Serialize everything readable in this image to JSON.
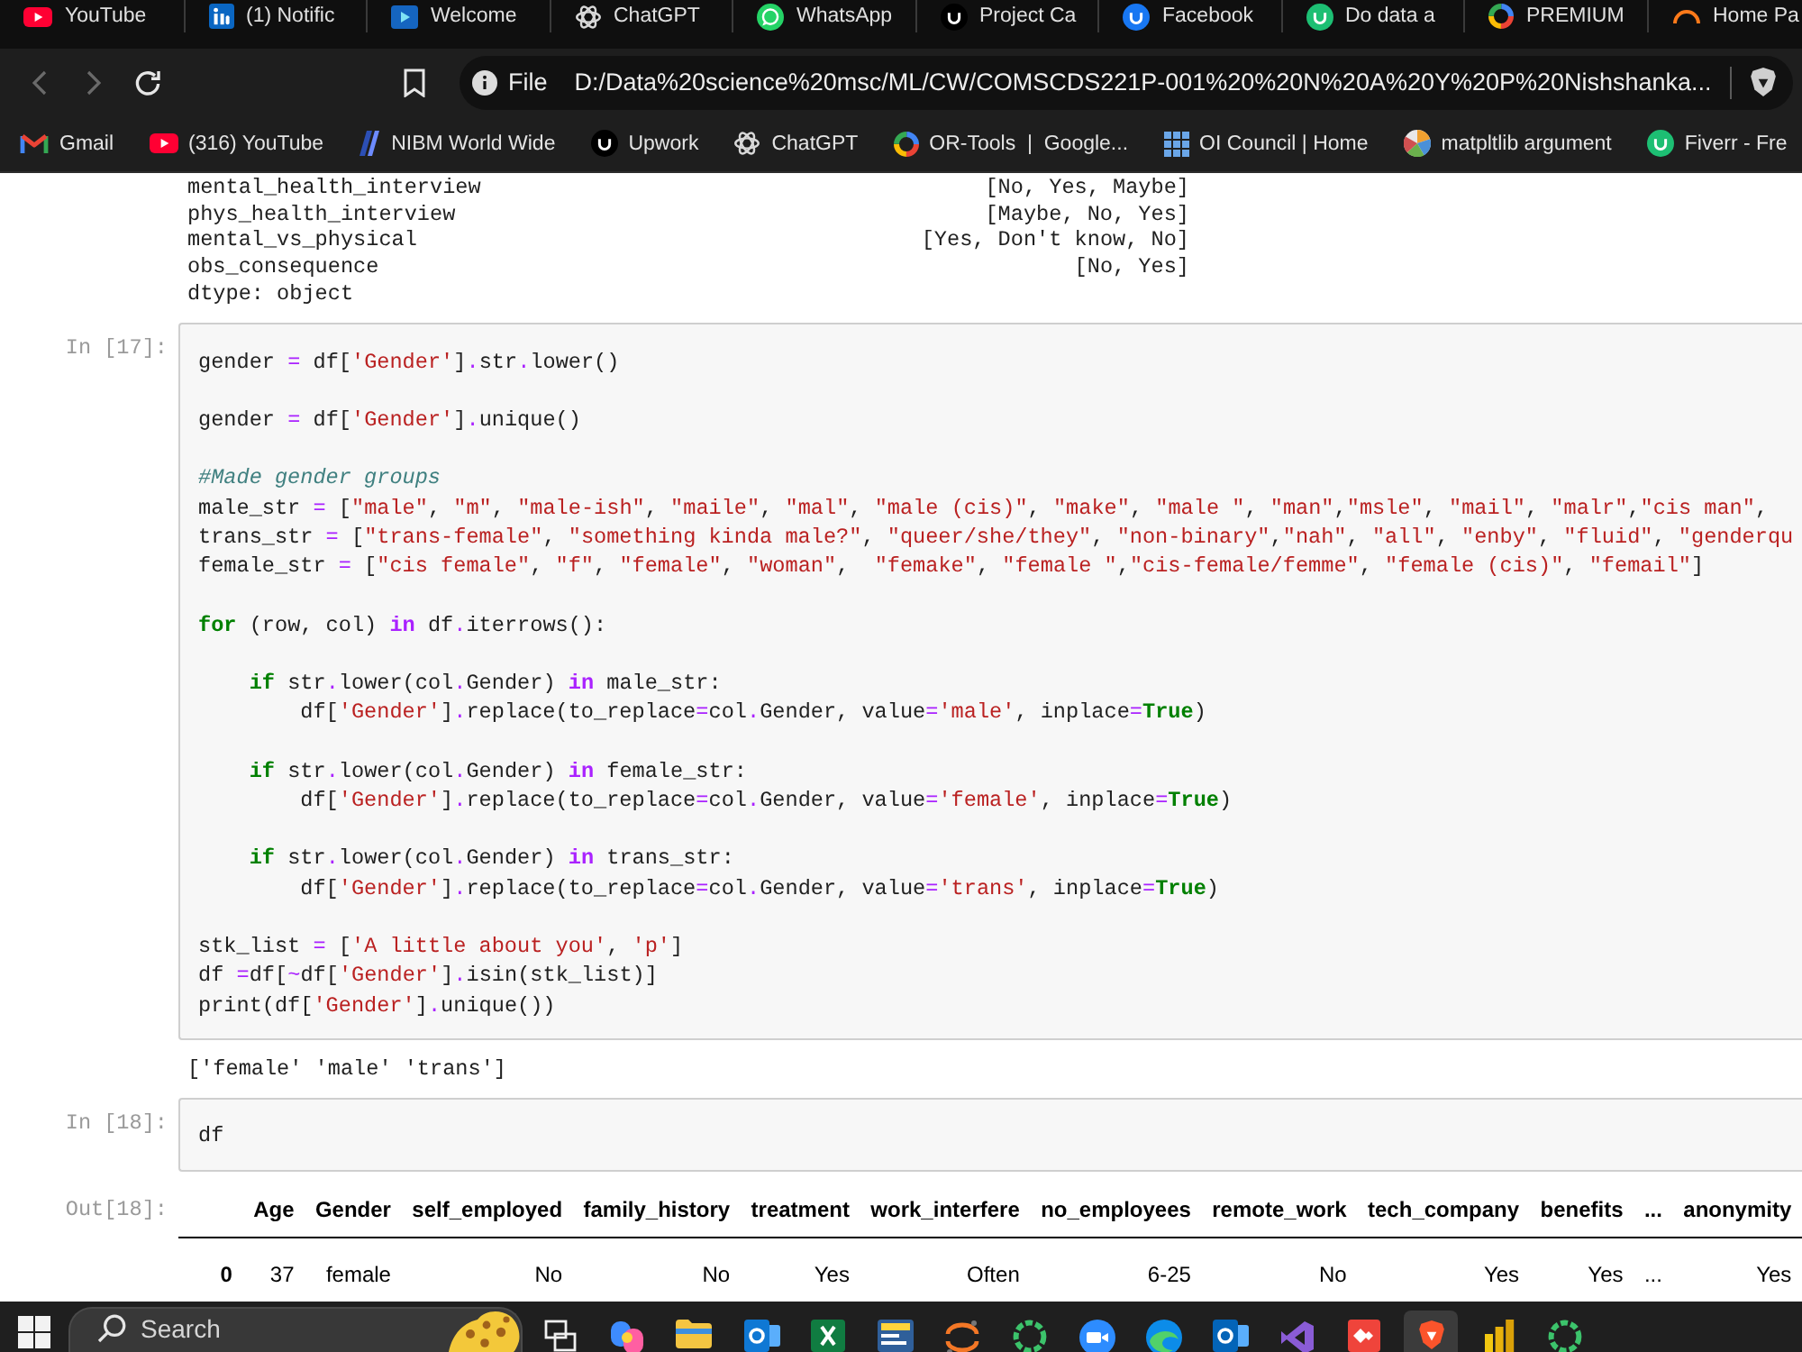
{
  "tabs": [
    {
      "label": "YouTube"
    },
    {
      "label": "(1) Notific"
    },
    {
      "label": "Welcome"
    },
    {
      "label": "ChatGPT"
    },
    {
      "label": "WhatsApp"
    },
    {
      "label": "Project Ca"
    },
    {
      "label": "Facebook"
    },
    {
      "label": "Do data a"
    },
    {
      "label": "PREMIUM"
    },
    {
      "label": "Home Pa"
    }
  ],
  "toolbar": {
    "back": {
      "disabled": true
    },
    "forward": {
      "disabled": true
    },
    "address": {
      "scheme": "File",
      "url": "D:/Data%20science%20msc/ML/CW/COMSCDS221P-001%20%20N%20A%20Y%20P%20Nishshanka..."
    }
  },
  "bookmarks": [
    {
      "label": "Gmail"
    },
    {
      "label": "(316) YouTube"
    },
    {
      "label": "NIBM World Wide"
    },
    {
      "label": "Upwork"
    },
    {
      "label": "ChatGPT"
    },
    {
      "label": "OR-Tools  |  Google..."
    },
    {
      "label": "OI Council | Home"
    },
    {
      "label": "matpltlib argument"
    },
    {
      "label": "Fiverr - Fre"
    }
  ],
  "notebook": {
    "cells": [
      {
        "kind": "series_output",
        "rows": [
          {
            "index": "mental_health_interview",
            "value": "[No, Yes, Maybe]"
          },
          {
            "index": "phys_health_interview",
            "value": "[Maybe, No, Yes]"
          },
          {
            "index": "mental_vs_physical",
            "value": "[Yes, Don't know, No]"
          },
          {
            "index": "obs_consequence",
            "value": "[No, Yes]"
          }
        ],
        "footer": "dtype: object"
      },
      {
        "kind": "code",
        "prompt": "In [17]:",
        "blocks": [
          [
            [
              {
                "kind": "plain",
                "text": "gender "
              },
              {
                "kind": "op",
                "text": "="
              },
              {
                "kind": "plain",
                "text": " df["
              },
              {
                "kind": "str",
                "text": "'Gender'"
              },
              {
                "kind": "plain",
                "text": "]"
              },
              {
                "kind": "op",
                "text": "."
              },
              {
                "kind": "plain",
                "text": "str"
              },
              {
                "kind": "op",
                "text": "."
              },
              {
                "kind": "plain",
                "text": "lower()"
              }
            ]
          ],
          [
            [
              {
                "kind": "plain",
                "text": "gender "
              },
              {
                "kind": "op",
                "text": "="
              },
              {
                "kind": "plain",
                "text": " df["
              },
              {
                "kind": "str",
                "text": "'Gender'"
              },
              {
                "kind": "plain",
                "text": "]"
              },
              {
                "kind": "op",
                "text": "."
              },
              {
                "kind": "plain",
                "text": "unique()"
              }
            ]
          ],
          [
            [
              {
                "kind": "comment",
                "text": "#Made gender groups"
              }
            ],
            [
              {
                "kind": "plain",
                "text": "male_str "
              },
              {
                "kind": "op",
                "text": "="
              },
              {
                "kind": "plain",
                "text": " ["
              },
              {
                "kind": "str",
                "text": "\"male\""
              },
              {
                "kind": "plain",
                "text": ", "
              },
              {
                "kind": "str",
                "text": "\"m\""
              },
              {
                "kind": "plain",
                "text": ", "
              },
              {
                "kind": "str",
                "text": "\"male-ish\""
              },
              {
                "kind": "plain",
                "text": ", "
              },
              {
                "kind": "str",
                "text": "\"maile\""
              },
              {
                "kind": "plain",
                "text": ", "
              },
              {
                "kind": "str",
                "text": "\"mal\""
              },
              {
                "kind": "plain",
                "text": ", "
              },
              {
                "kind": "str",
                "text": "\"male (cis)\""
              },
              {
                "kind": "plain",
                "text": ", "
              },
              {
                "kind": "str",
                "text": "\"make\""
              },
              {
                "kind": "plain",
                "text": ", "
              },
              {
                "kind": "str",
                "text": "\"male \""
              },
              {
                "kind": "plain",
                "text": ", "
              },
              {
                "kind": "str",
                "text": "\"man\""
              },
              {
                "kind": "plain",
                "text": ","
              },
              {
                "kind": "str",
                "text": "\"msle\""
              },
              {
                "kind": "plain",
                "text": ", "
              },
              {
                "kind": "str",
                "text": "\"mail\""
              },
              {
                "kind": "plain",
                "text": ", "
              },
              {
                "kind": "str",
                "text": "\"malr\""
              },
              {
                "kind": "plain",
                "text": ","
              },
              {
                "kind": "str",
                "text": "\"cis man\""
              },
              {
                "kind": "plain",
                "text": ","
              }
            ],
            [
              {
                "kind": "plain",
                "text": "trans_str "
              },
              {
                "kind": "op",
                "text": "="
              },
              {
                "kind": "plain",
                "text": " ["
              },
              {
                "kind": "str",
                "text": "\"trans-female\""
              },
              {
                "kind": "plain",
                "text": ", "
              },
              {
                "kind": "str",
                "text": "\"something kinda male?\""
              },
              {
                "kind": "plain",
                "text": ", "
              },
              {
                "kind": "str",
                "text": "\"queer/she/they\""
              },
              {
                "kind": "plain",
                "text": ", "
              },
              {
                "kind": "str",
                "text": "\"non-binary\""
              },
              {
                "kind": "plain",
                "text": ","
              },
              {
                "kind": "str",
                "text": "\"nah\""
              },
              {
                "kind": "plain",
                "text": ", "
              },
              {
                "kind": "str",
                "text": "\"all\""
              },
              {
                "kind": "plain",
                "text": ", "
              },
              {
                "kind": "str",
                "text": "\"enby\""
              },
              {
                "kind": "plain",
                "text": ", "
              },
              {
                "kind": "str",
                "text": "\"fluid\""
              },
              {
                "kind": "plain",
                "text": ", "
              },
              {
                "kind": "str",
                "text": "\"genderqu"
              }
            ],
            [
              {
                "kind": "plain",
                "text": "female_str "
              },
              {
                "kind": "op",
                "text": "="
              },
              {
                "kind": "plain",
                "text": " ["
              },
              {
                "kind": "str",
                "text": "\"cis female\""
              },
              {
                "kind": "plain",
                "text": ", "
              },
              {
                "kind": "str",
                "text": "\"f\""
              },
              {
                "kind": "plain",
                "text": ", "
              },
              {
                "kind": "str",
                "text": "\"female\""
              },
              {
                "kind": "plain",
                "text": ", "
              },
              {
                "kind": "str",
                "text": "\"woman\""
              },
              {
                "kind": "plain",
                "text": ",  "
              },
              {
                "kind": "str",
                "text": "\"femake\""
              },
              {
                "kind": "plain",
                "text": ", "
              },
              {
                "kind": "str",
                "text": "\"female \""
              },
              {
                "kind": "plain",
                "text": ","
              },
              {
                "kind": "str",
                "text": "\"cis-female/femme\""
              },
              {
                "kind": "plain",
                "text": ", "
              },
              {
                "kind": "str",
                "text": "\"female (cis)\""
              },
              {
                "kind": "plain",
                "text": ", "
              },
              {
                "kind": "str",
                "text": "\"femail\""
              },
              {
                "kind": "plain",
                "text": "]"
              }
            ]
          ],
          [
            [
              {
                "kind": "kw",
                "text": "for"
              },
              {
                "kind": "plain",
                "text": " (row, col) "
              },
              {
                "kind": "opword",
                "text": "in"
              },
              {
                "kind": "plain",
                "text": " df"
              },
              {
                "kind": "op",
                "text": "."
              },
              {
                "kind": "plain",
                "text": "iterrows():"
              }
            ]
          ],
          [
            [
              {
                "kind": "kw",
                "text": "    if"
              },
              {
                "kind": "plain",
                "text": " str"
              },
              {
                "kind": "op",
                "text": "."
              },
              {
                "kind": "plain",
                "text": "lower(col"
              },
              {
                "kind": "op",
                "text": "."
              },
              {
                "kind": "plain",
                "text": "Gender) "
              },
              {
                "kind": "opword",
                "text": "in"
              },
              {
                "kind": "plain",
                "text": " male_str:"
              }
            ],
            [
              {
                "kind": "plain",
                "text": "        df["
              },
              {
                "kind": "str",
                "text": "'Gender'"
              },
              {
                "kind": "plain",
                "text": "]"
              },
              {
                "kind": "op",
                "text": "."
              },
              {
                "kind": "plain",
                "text": "replace(to_replace"
              },
              {
                "kind": "op",
                "text": "="
              },
              {
                "kind": "plain",
                "text": "col"
              },
              {
                "kind": "op",
                "text": "."
              },
              {
                "kind": "plain",
                "text": "Gender, value"
              },
              {
                "kind": "op",
                "text": "="
              },
              {
                "kind": "str",
                "text": "'male'"
              },
              {
                "kind": "plain",
                "text": ", inplace"
              },
              {
                "kind": "op",
                "text": "="
              },
              {
                "kind": "kw",
                "text": "True"
              },
              {
                "kind": "plain",
                "text": ")"
              }
            ]
          ],
          [
            [
              {
                "kind": "kw",
                "text": "    if"
              },
              {
                "kind": "plain",
                "text": " str"
              },
              {
                "kind": "op",
                "text": "."
              },
              {
                "kind": "plain",
                "text": "lower(col"
              },
              {
                "kind": "op",
                "text": "."
              },
              {
                "kind": "plain",
                "text": "Gender) "
              },
              {
                "kind": "opword",
                "text": "in"
              },
              {
                "kind": "plain",
                "text": " female_str:"
              }
            ],
            [
              {
                "kind": "plain",
                "text": "        df["
              },
              {
                "kind": "str",
                "text": "'Gender'"
              },
              {
                "kind": "plain",
                "text": "]"
              },
              {
                "kind": "op",
                "text": "."
              },
              {
                "kind": "plain",
                "text": "replace(to_replace"
              },
              {
                "kind": "op",
                "text": "="
              },
              {
                "kind": "plain",
                "text": "col"
              },
              {
                "kind": "op",
                "text": "."
              },
              {
                "kind": "plain",
                "text": "Gender, value"
              },
              {
                "kind": "op",
                "text": "="
              },
              {
                "kind": "str",
                "text": "'female'"
              },
              {
                "kind": "plain",
                "text": ", inplace"
              },
              {
                "kind": "op",
                "text": "="
              },
              {
                "kind": "kw",
                "text": "True"
              },
              {
                "kind": "plain",
                "text": ")"
              }
            ]
          ],
          [
            [
              {
                "kind": "kw",
                "text": "    if"
              },
              {
                "kind": "plain",
                "text": " str"
              },
              {
                "kind": "op",
                "text": "."
              },
              {
                "kind": "plain",
                "text": "lower(col"
              },
              {
                "kind": "op",
                "text": "."
              },
              {
                "kind": "plain",
                "text": "Gender) "
              },
              {
                "kind": "opword",
                "text": "in"
              },
              {
                "kind": "plain",
                "text": " trans_str:"
              }
            ],
            [
              {
                "kind": "plain",
                "text": "        df["
              },
              {
                "kind": "str",
                "text": "'Gender'"
              },
              {
                "kind": "plain",
                "text": "]"
              },
              {
                "kind": "op",
                "text": "."
              },
              {
                "kind": "plain",
                "text": "replace(to_replace"
              },
              {
                "kind": "op",
                "text": "="
              },
              {
                "kind": "plain",
                "text": "col"
              },
              {
                "kind": "op",
                "text": "."
              },
              {
                "kind": "plain",
                "text": "Gender, value"
              },
              {
                "kind": "op",
                "text": "="
              },
              {
                "kind": "str",
                "text": "'trans'"
              },
              {
                "kind": "plain",
                "text": ", inplace"
              },
              {
                "kind": "op",
                "text": "="
              },
              {
                "kind": "kw",
                "text": "True"
              },
              {
                "kind": "plain",
                "text": ")"
              }
            ]
          ],
          [
            [
              {
                "kind": "plain",
                "text": "stk_list "
              },
              {
                "kind": "op",
                "text": "="
              },
              {
                "kind": "plain",
                "text": " ["
              },
              {
                "kind": "str",
                "text": "'A little about you'"
              },
              {
                "kind": "plain",
                "text": ", "
              },
              {
                "kind": "str",
                "text": "'p'"
              },
              {
                "kind": "plain",
                "text": "]"
              }
            ],
            [
              {
                "kind": "plain",
                "text": "df "
              },
              {
                "kind": "op",
                "text": "="
              },
              {
                "kind": "plain",
                "text": "df["
              },
              {
                "kind": "op",
                "text": "~"
              },
              {
                "kind": "plain",
                "text": "df["
              },
              {
                "kind": "str",
                "text": "'Gender'"
              },
              {
                "kind": "plain",
                "text": "]"
              },
              {
                "kind": "op",
                "text": "."
              },
              {
                "kind": "plain",
                "text": "isin(stk_list)]"
              }
            ],
            [
              {
                "kind": "plain",
                "text": "print(df["
              },
              {
                "kind": "str",
                "text": "'Gender'"
              },
              {
                "kind": "plain",
                "text": "]"
              },
              {
                "kind": "op",
                "text": "."
              },
              {
                "kind": "plain",
                "text": "unique())"
              }
            ]
          ]
        ]
      },
      {
        "kind": "stream_output",
        "text": "['female' 'male' 'trans']"
      },
      {
        "kind": "code",
        "prompt": "In [18]:",
        "blocks": [
          [
            [
              {
                "kind": "plain",
                "text": "df"
              }
            ]
          ]
        ]
      },
      {
        "kind": "table_output",
        "prompt": "Out[18]:",
        "columns": [
          "Age",
          "Gender",
          "self_employed",
          "family_history",
          "treatment",
          "work_interfere",
          "no_employees",
          "remote_work",
          "tech_company",
          "benefits",
          "...",
          "anonymity"
        ],
        "rows": [
          {
            "index": "0",
            "cells": [
              "37",
              "female",
              "No",
              "No",
              "Yes",
              "Often",
              "6-25",
              "No",
              "Yes",
              "Yes",
              "...",
              "Yes"
            ]
          }
        ]
      }
    ]
  },
  "taskbar": {
    "search": {
      "placeholder": "Search"
    },
    "apps": [
      {
        "active": false
      },
      {
        "active": false
      },
      {
        "active": false
      },
      {
        "active": false
      },
      {
        "active": false
      },
      {
        "active": false
      },
      {
        "active": false
      },
      {
        "active": false
      },
      {
        "active": false
      },
      {
        "active": false
      },
      {
        "active": false
      },
      {
        "active": false
      },
      {
        "active": false
      },
      {
        "active": true
      },
      {
        "active": false
      },
      {
        "active": false
      }
    ]
  }
}
